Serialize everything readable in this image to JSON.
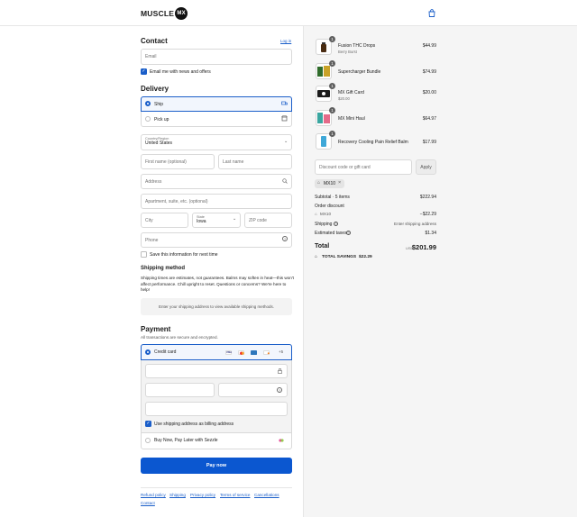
{
  "header": {
    "brand": "MUSCLE",
    "brand_badge": "MX"
  },
  "contact": {
    "title": "Contact",
    "login_link": "Log in",
    "email_placeholder": "Email",
    "newsletter_label": "Email me with news and offers"
  },
  "delivery": {
    "title": "Delivery",
    "options": [
      {
        "label": "Ship"
      },
      {
        "label": "Pick up"
      }
    ],
    "country_label": "Country/Region",
    "country_value": "United States",
    "first_name_placeholder": "First name (optional)",
    "last_name_placeholder": "Last name",
    "address_placeholder": "Address",
    "apartment_placeholder": "Apartment, suite, etc. (optional)",
    "city_placeholder": "City",
    "state_label": "State",
    "state_value": "Iowa",
    "zip_placeholder": "ZIP code",
    "phone_placeholder": "Phone",
    "save_info_label": "Save this information for next time"
  },
  "shipping_method": {
    "title": "Shipping method",
    "notice": "Shipping times are estimates, not guarantees. Balms may soften in heat—this won't affect performance. Chill upright to reset. Questions or concerns? We're here to help!",
    "placeholder_box": "Enter your shipping address to view available shipping methods."
  },
  "payment": {
    "title": "Payment",
    "subtitle": "All transactions are secure and encrypted.",
    "credit_card_label": "Credit card",
    "card_brands": [
      "VISA",
      "MC",
      "AMEX",
      "DISCOVER"
    ],
    "more_cards": "+5",
    "billing_label": "Use shipping address as billing address",
    "sezzle_label": "Buy Now, Pay Later with Sezzle",
    "pay_button": "Pay now"
  },
  "footer": {
    "links": [
      "Refund policy",
      "Shipping",
      "Privacy policy",
      "Terms of service",
      "Cancellations",
      "Contact"
    ]
  },
  "order": {
    "items": [
      {
        "name": "Fusion THC Drops",
        "variant": "Berry Burst",
        "price": "$44.99",
        "qty": "1"
      },
      {
        "name": "Supercharger Bundle",
        "variant": "",
        "price": "$74.99",
        "qty": "1"
      },
      {
        "name": "MX Gift Card",
        "variant": "$20.00",
        "price": "$20.00",
        "qty": "1"
      },
      {
        "name": "MX Mini Haul",
        "variant": "",
        "price": "$64.97",
        "qty": "1"
      },
      {
        "name": "Recovery Cooling Pain Relief Balm",
        "variant": "",
        "price": "$17.99",
        "qty": "1"
      }
    ],
    "discount_placeholder": "Discount code or gift card",
    "apply_button": "Apply",
    "applied_code": "MX10",
    "subtotal_label": "Subtotal · 5 items",
    "subtotal_value": "$222.94",
    "order_discount_label": "Order discount",
    "discount_code": "MX10",
    "discount_value": "−$22.29",
    "shipping_label": "Shipping",
    "shipping_value": "Enter shipping address",
    "taxes_label": "Estimated taxes",
    "taxes_value": "$1.34",
    "total_label": "Total",
    "currency": "USD",
    "total_value": "$201.99",
    "savings_label": "TOTAL SAVINGS",
    "savings_value": "$22.29"
  },
  "colors": {
    "accent": "#1a5ec9",
    "button": "#0b57d0"
  }
}
